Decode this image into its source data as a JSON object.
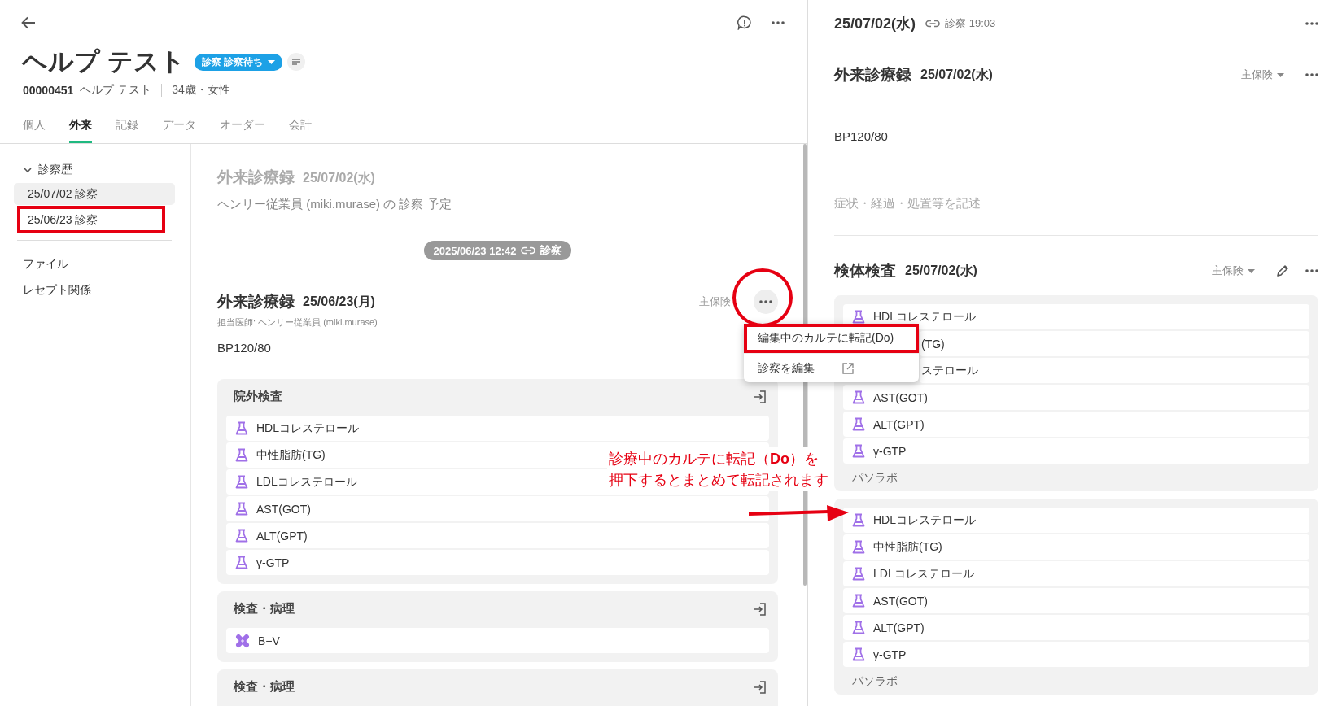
{
  "header": {
    "title": "ヘルプ テスト",
    "status_badge": "診察 診察待ち",
    "patient_id": "00000451",
    "patient_name": "ヘルプ テスト",
    "age_sex": "34歳・女性"
  },
  "tabs": [
    {
      "label": "個人",
      "selected": false
    },
    {
      "label": "外来",
      "selected": true
    },
    {
      "label": "記録",
      "selected": false
    },
    {
      "label": "データ",
      "selected": false
    },
    {
      "label": "オーダー",
      "selected": false
    },
    {
      "label": "会計",
      "selected": false
    }
  ],
  "sidebar": {
    "groups": [
      {
        "label": "診察歴",
        "expanded": true,
        "children": [
          {
            "label": "25/07/02 診察",
            "selected": true,
            "highlighted": false
          },
          {
            "label": "25/06/23 診察",
            "selected": false,
            "highlighted": true
          }
        ]
      }
    ],
    "links": [
      "ファイル",
      "レセプト関係"
    ]
  },
  "timeline": {
    "upcoming": {
      "title": "外来診療録",
      "date": "25/07/02(水)",
      "note": "ヘンリー従業員 (miki.murase) の 診察 予定"
    },
    "separator": {
      "datetime": "2025/06/23 12:42",
      "label": "診察"
    },
    "record": {
      "title": "外来診療録",
      "date": "25/06/23(月)",
      "insurance": "主保険",
      "doctor": "担当医師: ヘンリー従業員 (miki.murase)",
      "note": "BP120/80",
      "sections": [
        {
          "title": "院外検査",
          "items": [
            {
              "label": "HDLコレステロール",
              "kind": "lab"
            },
            {
              "label": "中性脂肪(TG)",
              "kind": "lab"
            },
            {
              "label": "LDLコレステロール",
              "kind": "lab"
            },
            {
              "label": "AST(GOT)",
              "kind": "lab"
            },
            {
              "label": "ALT(GPT)",
              "kind": "lab"
            },
            {
              "label": "γ-GTP",
              "kind": "lab"
            }
          ]
        },
        {
          "title": "検査・病理",
          "items": [
            {
              "label": "B−V",
              "kind": "bandage"
            }
          ]
        },
        {
          "title": "検査・病理"
        }
      ]
    }
  },
  "context_menu": {
    "items": [
      {
        "label": "編集中のカルテに転記(Do)",
        "kind": "plain",
        "highlighted": true
      },
      {
        "label": "診察を編集",
        "kind": "external",
        "highlighted": false
      }
    ]
  },
  "right": {
    "date": "25/07/02(水)",
    "link_label": "診察 19:03",
    "record": {
      "title": "外来診療録",
      "date": "25/07/02(水)",
      "insurance": "主保険",
      "note": "BP120/80",
      "placeholder": "症状・経過・処置等を記述"
    },
    "specimen": {
      "title": "検体検査",
      "date": "25/07/02(水)",
      "insurance": "主保険",
      "groups": [
        {
          "items": [
            {
              "label": "HDLコレステロール",
              "kind": "lab"
            },
            {
              "label": "(TG)",
              "kind": "covered"
            },
            {
              "label": "ステロール",
              "kind": "covered"
            },
            {
              "label": "AST(GOT)",
              "kind": "lab"
            },
            {
              "label": "ALT(GPT)",
              "kind": "lab"
            },
            {
              "label": "γ-GTP",
              "kind": "lab"
            }
          ],
          "footer": "パソラボ"
        },
        {
          "items": [
            {
              "label": "HDLコレステロール",
              "kind": "lab"
            },
            {
              "label": "中性脂肪(TG)",
              "kind": "lab"
            },
            {
              "label": "LDLコレステロール",
              "kind": "lab"
            },
            {
              "label": "AST(GOT)",
              "kind": "lab"
            },
            {
              "label": "ALT(GPT)",
              "kind": "lab"
            },
            {
              "label": "γ-GTP",
              "kind": "lab"
            }
          ],
          "footer": "パソラボ"
        }
      ]
    }
  },
  "annotation": {
    "lines": [
      "診療中のカルテに転記（**Do**）を",
      "押下するとまとめて転記されます"
    ]
  }
}
